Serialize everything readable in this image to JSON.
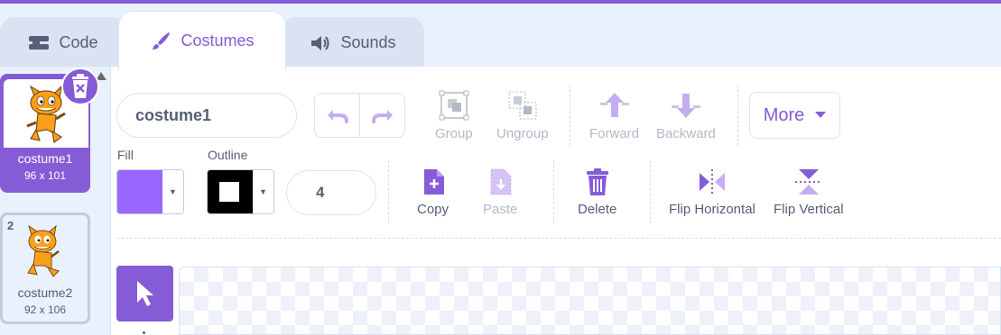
{
  "tabs": [
    {
      "label": "Code",
      "icon": "code-blocks-icon"
    },
    {
      "label": "Costumes",
      "icon": "paintbrush-icon",
      "selected": true
    },
    {
      "label": "Sounds",
      "icon": "speaker-icon"
    }
  ],
  "costumes": [
    {
      "number": "1",
      "name": "costume1",
      "size": "96 x 101",
      "selected": true
    },
    {
      "number": "2",
      "name": "costume2",
      "size": "92 x 106",
      "selected": false
    }
  ],
  "editor": {
    "costume_name": "costume1",
    "toolbar": {
      "group": "Group",
      "ungroup": "Ungroup",
      "forward": "Forward",
      "backward": "Backward",
      "more": "More"
    },
    "fill_label": "Fill",
    "outline_label": "Outline",
    "outline_width": "4",
    "actions": {
      "copy": "Copy",
      "paste": "Paste",
      "delete": "Delete",
      "flip_horizontal": "Flip Horizontal",
      "flip_vertical": "Flip Vertical"
    }
  },
  "colors": {
    "accent": "#855cd6",
    "fill": "#9966ff",
    "outline": "#000000",
    "text": "#575e75",
    "disabled": "#b3b8c7"
  }
}
